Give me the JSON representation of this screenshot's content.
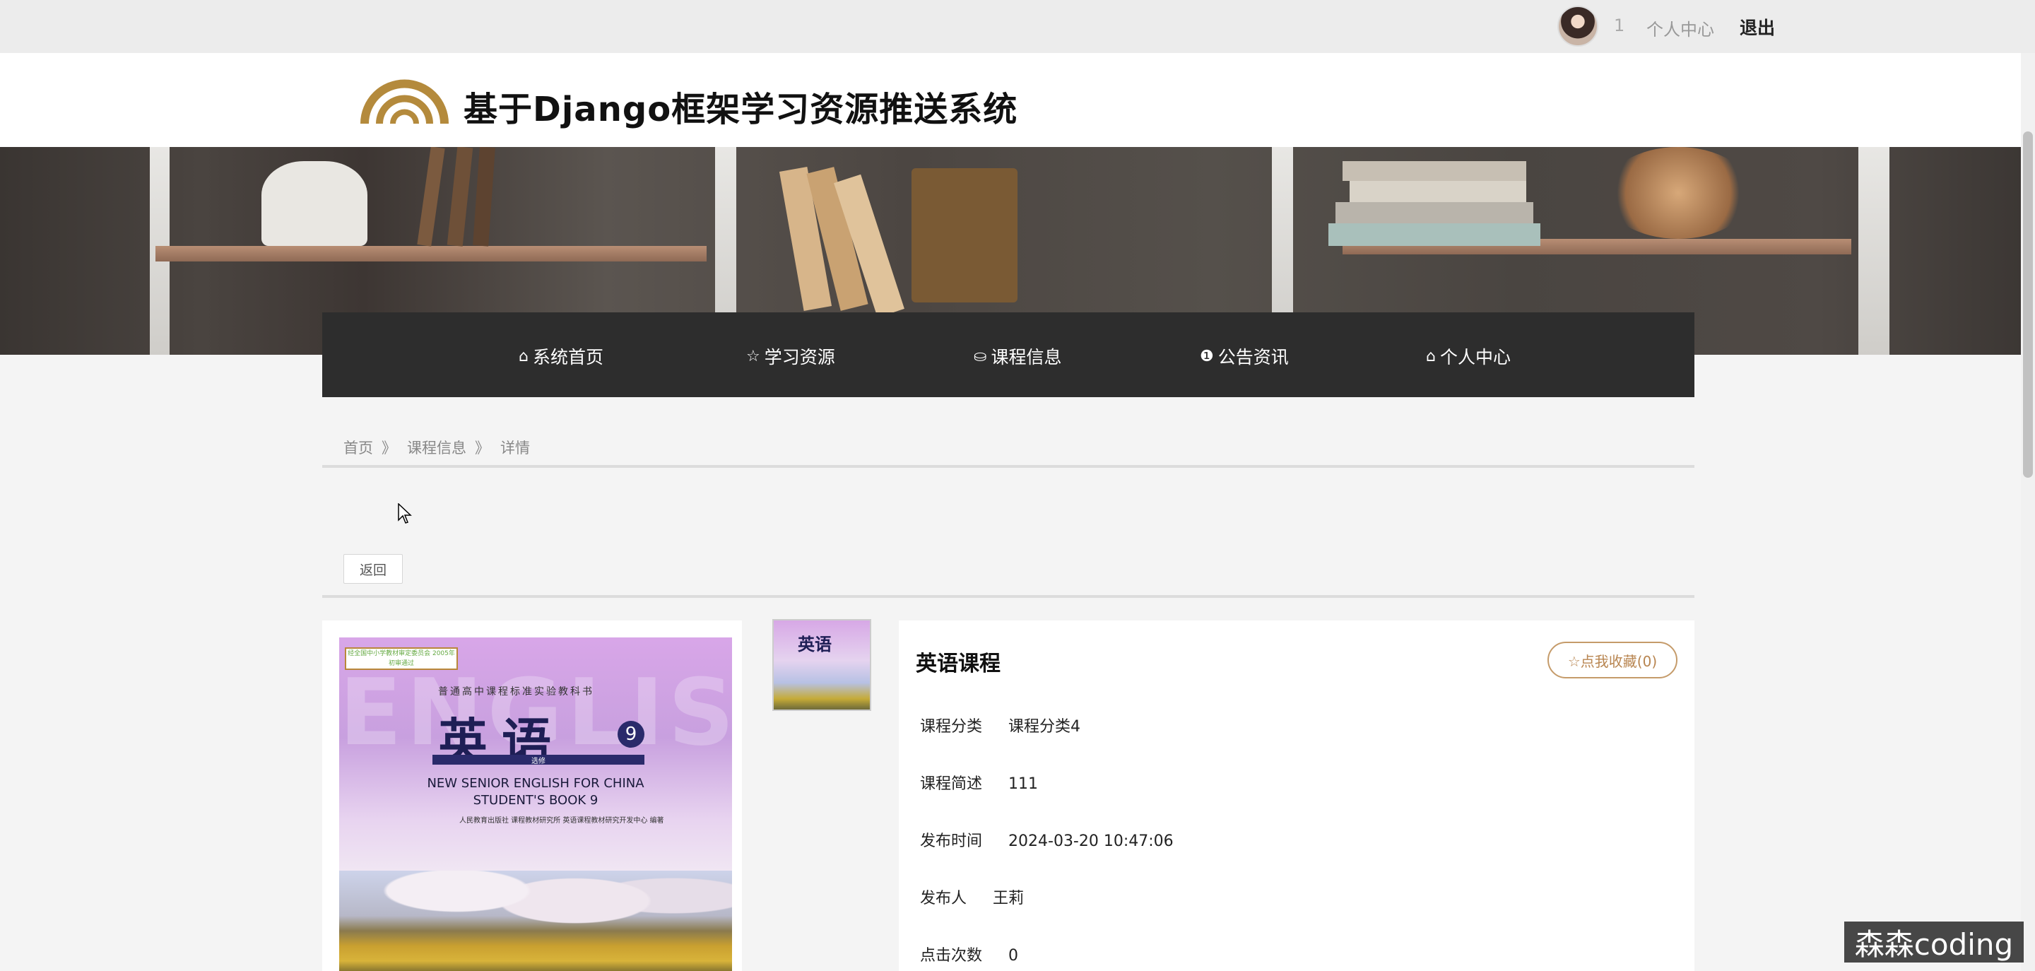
{
  "topbar": {
    "user_id": "1",
    "user_center": "个人中心",
    "logout": "退出"
  },
  "header": {
    "site_title": "基于Django框架学习资源推送系统",
    "logo_color": "#b48a3c"
  },
  "nav": {
    "items": [
      {
        "label": "系统首页",
        "icon": "home-icon",
        "glyph": "⌂"
      },
      {
        "label": "学习资源",
        "icon": "star-icon",
        "glyph": "☆"
      },
      {
        "label": "课程信息",
        "icon": "bag-icon",
        "glyph": "⛀"
      },
      {
        "label": "公告资讯",
        "icon": "info-icon",
        "glyph": "❶"
      },
      {
        "label": "个人中心",
        "icon": "home-icon",
        "glyph": "⌂"
      }
    ]
  },
  "breadcrumb": {
    "home": "首页",
    "sep": "》",
    "course": "课程信息",
    "detail": "详情"
  },
  "back_button": "返回",
  "cover": {
    "badge": "经全国中小学教材审定委员会 2005年初审通过",
    "subtitle": "普通高中课程标准实验教科书",
    "title": "英语",
    "volume": "9",
    "tag": "选修",
    "en_line1": "NEW SENIOR ENGLISH FOR CHINA",
    "en_line2": "STUDENT'S BOOK 9",
    "publisher": "人民教育出版社 课程教材研究所 英语课程教材研究开发中心 编著",
    "ghost": "ENGLISH"
  },
  "details": {
    "title": "英语课程",
    "favorite_button": "☆点我收藏(0)",
    "fields": [
      {
        "label": "课程分类",
        "value": "课程分类4"
      },
      {
        "label": "课程简述",
        "value": "111"
      },
      {
        "label": "发布时间",
        "value": "2024-03-20 10:47:06"
      },
      {
        "label": "发布人",
        "value": "王莉"
      },
      {
        "label": "点击次数",
        "value": "0"
      }
    ]
  },
  "watermark": "森森coding",
  "colors": {
    "nav_bg": "#2d2d2d",
    "accent": "#c59b6a"
  }
}
